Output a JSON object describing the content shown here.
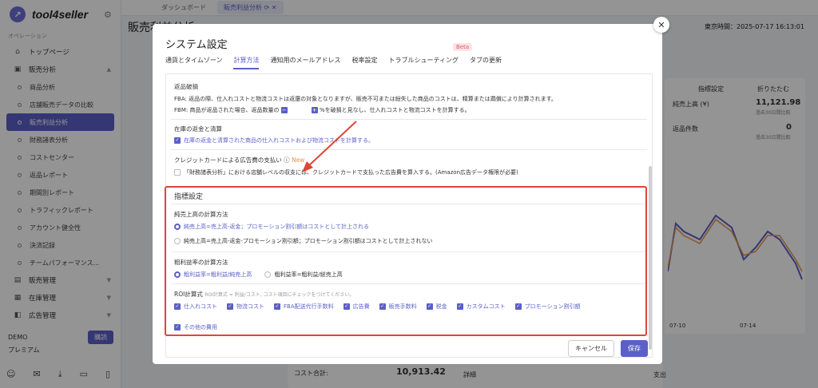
{
  "app": {
    "name": "tool4seller",
    "section_label": "オペレーション"
  },
  "sidebar": {
    "items": [
      {
        "label": "トップページ",
        "icon": "home-icon"
      },
      {
        "label": "販売分析",
        "icon": "cart-icon"
      }
    ],
    "subitems": [
      "商品分析",
      "店舗販売データの比較",
      "販売利益分析",
      "財務諸表分析",
      "コストセンター",
      "返品レポート",
      "期間別レポート",
      "トラフィックレポート",
      "アカウント健全性",
      "決済記録",
      "チームパフォーマンス..."
    ],
    "active_sub": "販売利益分析",
    "groups": [
      "販売管理",
      "在庫管理",
      "広告管理"
    ],
    "plan_name": "DEMO",
    "plan_tier": "プレミアム",
    "upgrade_label": "購読"
  },
  "topbar": {
    "tabs": [
      "ダッシュボード",
      "販売利益分析"
    ]
  },
  "background": {
    "title": "販売利益分析",
    "time": "東京時間：2025-07-17 16:13:01",
    "metric1_label": "純売上高 (¥)",
    "metric1_value": "11,121.98",
    "metric1_sub": "過去30日間比較",
    "metric2_label": "返品件数",
    "metric2_value": "0",
    "metric2_sub": "過去30日間比較",
    "settings_label": "指標設定",
    "collapse_label": "折りたたむ",
    "cost_total_label": "コスト合計:",
    "cost_total_value": "10,913.42",
    "detail_label": "詳細",
    "expense_label": "支出",
    "date1": "07-10",
    "date2": "07-14"
  },
  "modal": {
    "title": "システム設定",
    "tabs": [
      "通貨とタイムゾーン",
      "計算方法",
      "通知用のメールアドレス",
      "税率設定",
      "トラブルシューティング",
      "タブの更新"
    ],
    "active_tab": "計算方法",
    "beta": "Beta",
    "returns": {
      "heading": "返品破損",
      "fba_text": "FBA: 返品の際、仕入れコストと物流コストは返還の対象となりますが、販売不可または紛失した商品のコストは、精算または鵡償により計算されます。",
      "fbm_prefix": "FBM: 商品が返品された場合、返品数量の",
      "fbm_suffix": "%を破損と見なし、仕入れコストと物流コストを計算する。"
    },
    "refund": {
      "heading": "在庫の返金と清算",
      "label": "在庫の返金と清算された商品の仕入れコストおよび物流コストを計算する。"
    },
    "credit": {
      "heading": "クレジットカードによる広告費の支払い",
      "badge": "New",
      "label": "「財務諸表分析」における店舗レベルの収支には、クレジットカードで支払った広告費を算入する。(Amazon広告データ権限が必要)"
    },
    "metrics": {
      "heading": "指標設定",
      "net_sales_heading": "純売上高の計算方法",
      "net_opt1": "純売上高=売上高-返金；プロモーション割引額はコストとして計上される",
      "net_opt2": "純売上高=売上高-返金-プロモーション割引額；プロモーション割引額はコストとして計上されない",
      "margin_heading": "粗利益率の計算方法",
      "margin_opt1": "粗利益率=粗利益/純売上高",
      "margin_opt2": "粗利益率=粗利益/総売上高",
      "roi_heading": "ROI計算式",
      "roi_hint": "ROI計算式 = 利益/コスト, コスト項目にチェックをつけてください。",
      "roi_items": [
        "仕入れコスト",
        "物流コスト",
        "FBA配送代行手数料",
        "広告費",
        "販売手数料",
        "税金",
        "カスタムコスト",
        "プロモーション割引額",
        "その他の費用"
      ]
    },
    "cancel_label": "キャンセル",
    "save_label": "保存"
  },
  "colors": {
    "accent": "#5b5fc7",
    "highlight": "#e0453a",
    "arrow": "#e0453a"
  }
}
